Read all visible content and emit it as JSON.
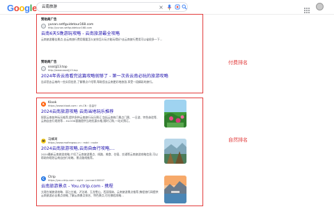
{
  "header": {
    "logo_letters": [
      "G",
      "o",
      "o",
      "g",
      "l",
      "e"
    ],
    "logo_colors": [
      "#4285f4",
      "#ea4335",
      "#fbbc05",
      "#4285f4",
      "#34a853",
      "#ea4335"
    ],
    "search_query": "云南旅游",
    "clear_icon": "×",
    "mic_icon": "mic-icon",
    "lens_icon": "lens-icon",
    "search_icon": "search-icon"
  },
  "labels": {
    "paid": "付费排名",
    "organic": "自然排名"
  },
  "ads": [
    {
      "sponsored": "赞助商广告",
      "site_name": "yunan.setfguidetour168.com",
      "site_url": "http://yunan.setfguidetour168.com",
      "title": "云南6天5晚游玩攻略 - 云南旅游最全攻略",
      "snippet": "云南旅游最佳景点,去云南旅行费用需要怎么安排怎么玩才能玩得好?去云南旅行费用可以省很多一下..."
    },
    {
      "sponsored": "赞助商广告",
      "site_name": "ssssljj13.top",
      "site_url": "http://www.ssssljj13.top",
      "title": "2024年去云南看完这篇攻略就够了 - 第一次去云南必玩的旅游攻略",
      "snippet": "告诉您去云南的一些实用信息,了解景点介绍等,帮助您去云南更好地旅游,享受一段精彩的旅行。"
    }
  ],
  "organic": [
    {
      "site_name": "Klook",
      "site_url": "https://www.klook.com › zh-CN › 自由行",
      "title": "2024云南旅游攻略 云南当地玩乐推荐",
      "snippet": "探索云南各种玩乐推荐,提供多种云南旅行玩乐预订,包括云南热门景点门票、一日游、特色体验等,云南自由行规划等... KLOOK客路提供当地优惠价格,随时订购,一站式预订。"
    },
    {
      "site_name": "马蜂窝",
      "site_url": "https://www.mafengwo.cn › mdd › route",
      "title": "2024云南旅游攻略,云南自由行攻略,...",
      "snippet": "2024最新云南旅游攻略,介绍了云南旅游景点、线路、美食、住宿、交通等云南旅游攻略信息,可以帮助你规划云南自由行攻略、景点路线推荐。"
    },
    {
      "site_name": "Ctrip",
      "site_url": "https://you.ctrip.com › sight › yunnan100007",
      "title": "云南旅游景点 - You.ctrip.com - 携程",
      "snippet": "大理古城旅游攻略、丽江古城、泸沽湖、玉龙雪山、西双版纳、云南旅游景点推荐,携程旅行网提供云南旅游必去景点攻略,了解云南景点排名、特色景点,尽在携程攻略..."
    }
  ],
  "colors": {
    "accent_red": "#e23b3b",
    "link_blue": "#1a0dab"
  }
}
